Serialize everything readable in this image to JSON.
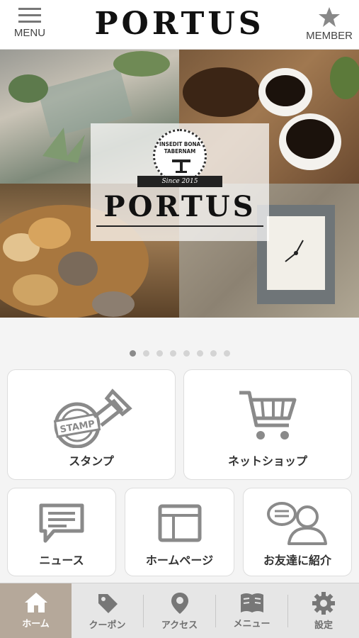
{
  "header": {
    "menu_label": "MENU",
    "logo_text": "PORTUS",
    "member_label": "MEMBER"
  },
  "hero": {
    "emblem_motto_line1": "INSEDIT BONA",
    "emblem_motto_line2": "TABERNAM",
    "emblem_since": "Since 2015",
    "emblem_name": "PORTUS",
    "slides_total": 8,
    "active_slide": 1
  },
  "cards": {
    "stamp": {
      "label": "スタンプ",
      "icon_text": "STAMP"
    },
    "shop": {
      "label": "ネットショップ"
    },
    "news": {
      "label": "ニュース"
    },
    "homepage": {
      "label": "ホームページ"
    },
    "friend": {
      "label": "お友達に紹介"
    }
  },
  "tabs": [
    {
      "label": "ホーム",
      "icon": "home-icon",
      "active": true
    },
    {
      "label": "クーポン",
      "icon": "tag-icon",
      "active": false
    },
    {
      "label": "アクセス",
      "icon": "map-pin-icon",
      "active": false
    },
    {
      "label": "メニュー",
      "icon": "book-icon",
      "active": false
    },
    {
      "label": "設定",
      "icon": "gear-icon",
      "active": false
    }
  ],
  "colors": {
    "tab_active_bg": "#b5a89a",
    "tab_bar_bg": "#e6e6e6",
    "icon_gray": "#8a8a8a"
  }
}
